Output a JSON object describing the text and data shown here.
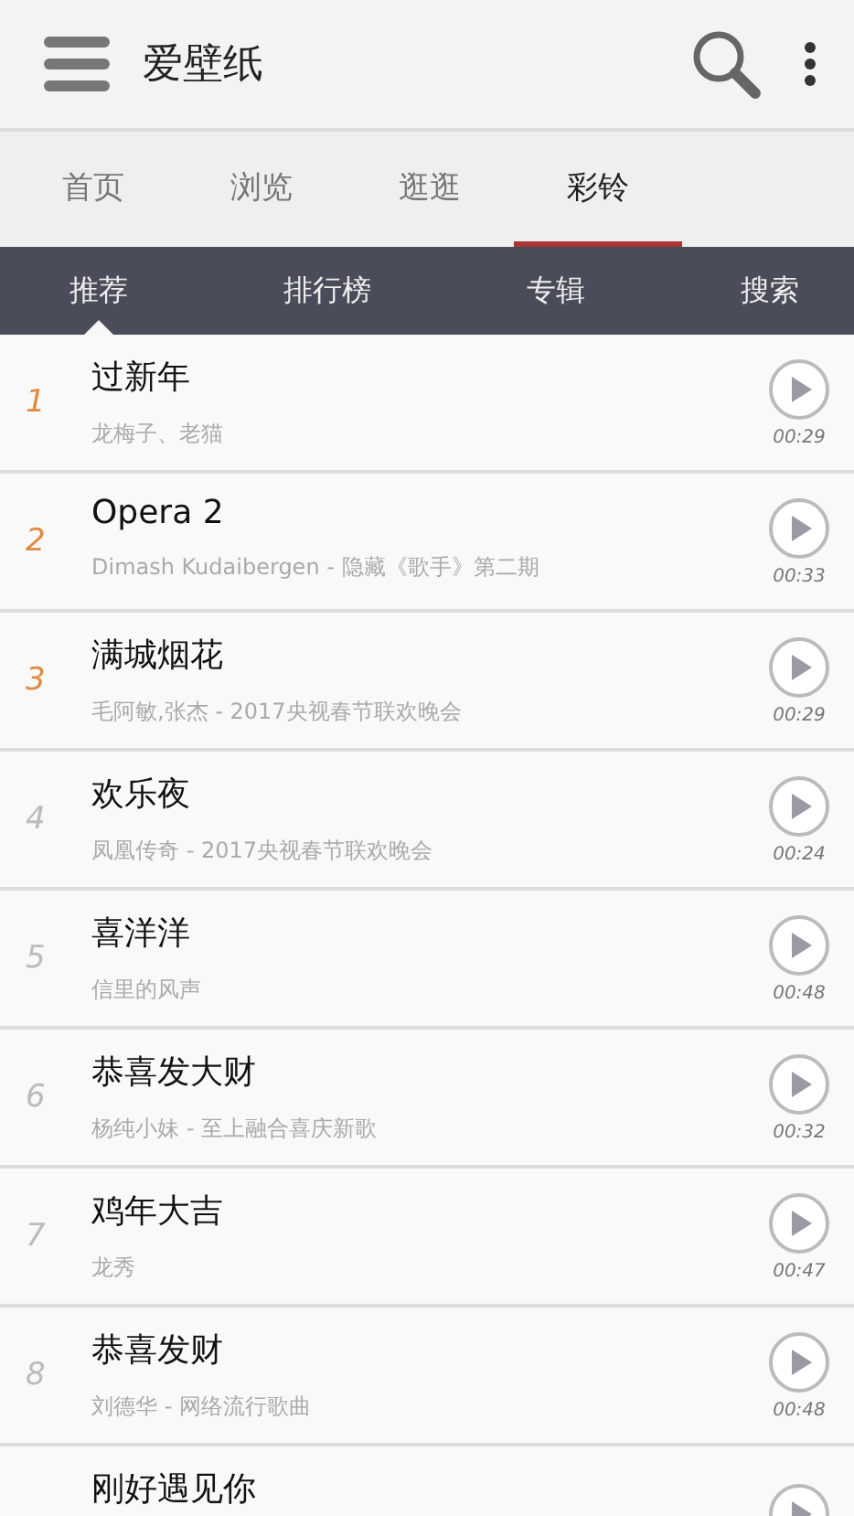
{
  "app_bar": {
    "title": "爱壁纸"
  },
  "tabs": [
    {
      "label": "首页",
      "selected": false
    },
    {
      "label": "浏览",
      "selected": false
    },
    {
      "label": "逛逛",
      "selected": false
    },
    {
      "label": "彩铃",
      "selected": true
    }
  ],
  "sub_tabs": [
    {
      "label": "推荐",
      "selected": true
    },
    {
      "label": "排行榜",
      "selected": false
    },
    {
      "label": "专辑",
      "selected": false
    },
    {
      "label": "搜索",
      "selected": false
    }
  ],
  "songs": [
    {
      "rank": "1",
      "highlighted": true,
      "title": "过新年",
      "artist": "龙梅子、老猫",
      "duration": "00:29"
    },
    {
      "rank": "2",
      "highlighted": true,
      "title": "Opera 2",
      "artist": "Dimash Kudaibergen - 隐藏《歌手》第二期",
      "duration": "00:33"
    },
    {
      "rank": "3",
      "highlighted": true,
      "title": "满城烟花",
      "artist": "毛阿敏,张杰 - 2017央视春节联欢晚会",
      "duration": "00:29"
    },
    {
      "rank": "4",
      "highlighted": false,
      "title": "欢乐夜",
      "artist": "凤凰传奇 - 2017央视春节联欢晚会",
      "duration": "00:24"
    },
    {
      "rank": "5",
      "highlighted": false,
      "title": "喜洋洋",
      "artist": "信里的风声",
      "duration": "00:48"
    },
    {
      "rank": "6",
      "highlighted": false,
      "title": "恭喜发大财",
      "artist": "杨纯小妹 - 至上融合喜庆新歌",
      "duration": "00:32"
    },
    {
      "rank": "7",
      "highlighted": false,
      "title": "鸡年大吉",
      "artist": "龙秀",
      "duration": "00:47"
    },
    {
      "rank": "8",
      "highlighted": false,
      "title": "恭喜发财",
      "artist": "刘德华 - 网络流行歌曲",
      "duration": "00:48"
    },
    {
      "title": "刚好遇见你"
    }
  ]
}
